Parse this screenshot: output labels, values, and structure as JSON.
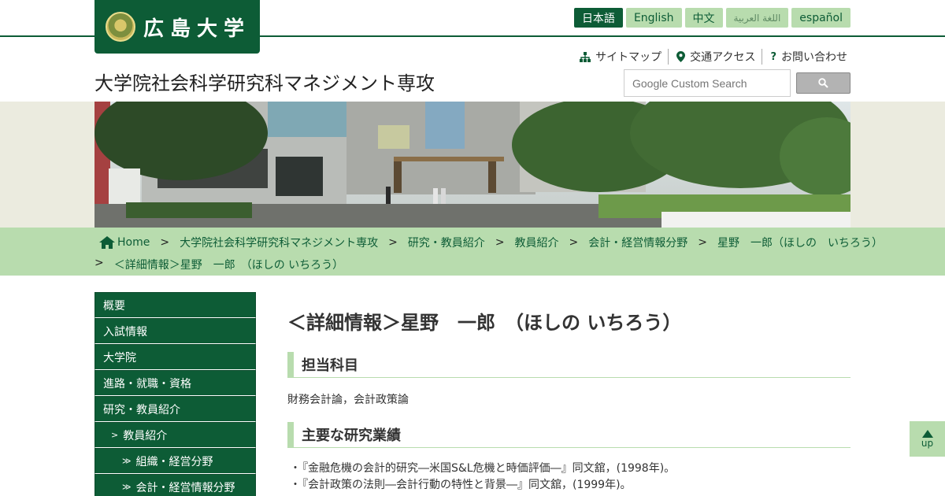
{
  "header": {
    "logo_text": "広島大学",
    "site_title": "大学院社会科学研究科マネジメント専攻",
    "languages": [
      {
        "label": "日本語",
        "active": true
      },
      {
        "label": "English",
        "active": false
      },
      {
        "label": "中文",
        "active": false
      },
      {
        "label": "اللغة العربية",
        "active": false
      },
      {
        "label": "español",
        "active": false
      }
    ],
    "util_nav": [
      {
        "label": "サイトマップ",
        "icon": "sitemap-icon"
      },
      {
        "label": "交通アクセス",
        "icon": "location-pin-icon"
      },
      {
        "label": "お問い合わせ",
        "icon": "question-icon"
      }
    ],
    "search": {
      "placeholder": "Google Custom Search"
    }
  },
  "breadcrumb": {
    "items": [
      "Home",
      "大学院社会科学研究科マネジメント専攻",
      "研究・教員紹介",
      "教員紹介",
      "会計・経営情報分野",
      "星野　一郎（ほしの　いちろう）"
    ],
    "current": "＜詳細情報＞星野　一郎　（ほしの いちろう）",
    "separator": ">"
  },
  "sidebar": {
    "items": [
      {
        "label": "概要"
      },
      {
        "label": "入試情報"
      },
      {
        "label": "大学院"
      },
      {
        "label": "進路・就職・資格"
      },
      {
        "label": "研究・教員紹介"
      },
      {
        "label": "教員紹介",
        "marker": ">"
      },
      {
        "label": "組織・経営分野",
        "marker": "≫"
      },
      {
        "label": "会計・経営情報分野",
        "marker": "≫"
      }
    ]
  },
  "main": {
    "title": "＜詳細情報＞星野　一郎　（ほしの いちろう）",
    "section1": {
      "heading": "担当科目",
      "text": "財務会計論，会計政策論"
    },
    "section2": {
      "heading": "主要な研究業績",
      "items": [
        "『金融危機の会計的研究―米国S&L危機と時価評価―』同文舘，(1998年)。",
        "『会計政策の法則―会計行動の特性と背景―』同文舘，(1999年)。"
      ]
    }
  },
  "up_button": {
    "label": "up"
  },
  "colors": {
    "primary": "#0d5c36",
    "light": "#b8dcae",
    "band": "#ebebdf"
  }
}
